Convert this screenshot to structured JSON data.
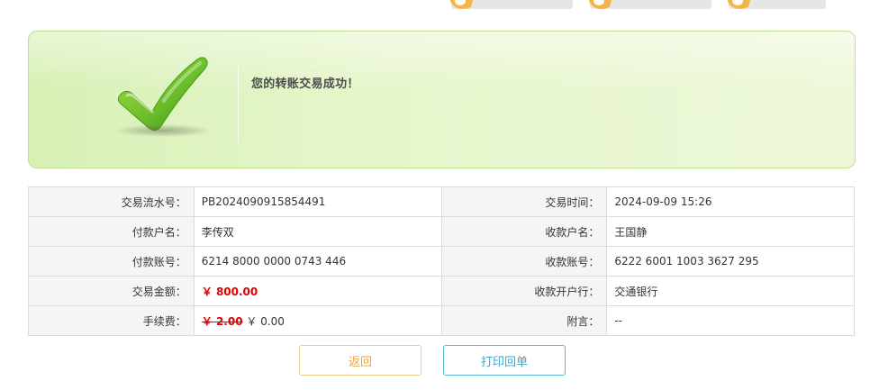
{
  "steps": [
    {
      "name": "step-1"
    },
    {
      "name": "step-2"
    },
    {
      "name": "step-3"
    }
  ],
  "success": {
    "message": "您的转账交易成功！"
  },
  "details": {
    "rows": [
      {
        "left_label": "交易流水号：",
        "left_value": "PB2024090915854491",
        "right_label": "交易时间：",
        "right_value": "2024-09-09 15:26"
      },
      {
        "left_label": "付款户名：",
        "left_value": "李传双",
        "right_label": "收款户名：",
        "right_value": "王国静"
      },
      {
        "left_label": "付款账号：",
        "left_value": "6214 8000 0000 0743 446",
        "right_label": "收款账号：",
        "right_value": "6222 6001 1003 3627 295"
      },
      {
        "left_label": "交易金额：",
        "left_value": "￥ 800.00",
        "right_label": "收款开户行：",
        "right_value": "交通银行"
      },
      {
        "left_label": "手续费：",
        "left_value_struck": "￥ 2.00",
        "left_value": "￥ 0.00",
        "right_label": "附言：",
        "right_value": "--"
      }
    ]
  },
  "buttons": {
    "back_label": "返回",
    "print_label": "打印回单"
  },
  "colors": {
    "accent_orange": "#f3b54a",
    "success_green": "#6cbf2a",
    "amount_red": "#e00000",
    "print_blue": "#3aa7cc"
  }
}
